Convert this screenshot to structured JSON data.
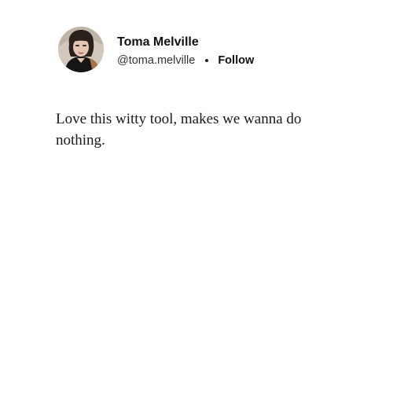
{
  "author": {
    "display_name": "Toma Melville",
    "handle": "@toma.melville",
    "separator": "•",
    "follow_label": "Follow"
  },
  "post": {
    "text": "Love this witty tool, makes we wanna do nothing."
  },
  "colors": {
    "background": "#ffffff",
    "text": "#111111"
  }
}
